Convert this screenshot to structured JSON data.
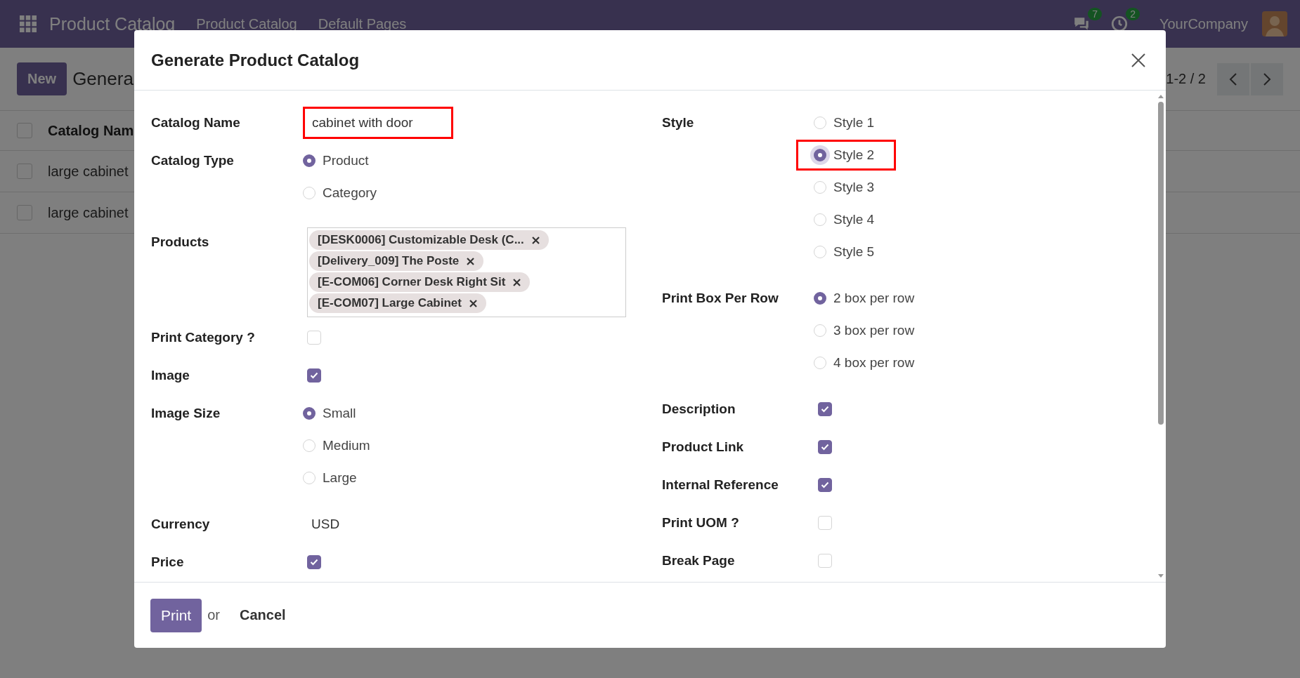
{
  "navbar": {
    "brand": "Product Catalog",
    "menus": [
      "Product Catalog",
      "Default Pages"
    ],
    "messages_badge": "7",
    "activities_badge": "2",
    "company": "YourCompany"
  },
  "control_panel": {
    "new_button": "New",
    "breadcrumb": "Genera",
    "pager": "1-2 / 2"
  },
  "list": {
    "select_all_checked": false,
    "columns": [
      "Catalog Nam"
    ],
    "rows": [
      {
        "checked": false,
        "cells": [
          "large cabinet"
        ]
      },
      {
        "checked": false,
        "cells": [
          "large cabinet"
        ]
      }
    ]
  },
  "dialog": {
    "title": "Generate Product Catalog",
    "left_fields": [
      {
        "label": "Catalog Name",
        "kind": "text",
        "value": "cabinet with door",
        "highlighted": true
      },
      {
        "label": "Catalog Type",
        "kind": "radio",
        "options": [
          {
            "label": "Product",
            "selected": true
          },
          {
            "label": "Category",
            "selected": false
          }
        ]
      },
      {
        "label": "Products",
        "kind": "tags",
        "tags": [
          "[DESK0006] Customizable Desk (C...",
          "[Delivery_009] The Poste",
          "[E-COM06] Corner Desk Right Sit",
          "[E-COM07] Large Cabinet"
        ]
      },
      {
        "label": "Print Category ?",
        "kind": "checkbox",
        "checked": false
      },
      {
        "label": "Image",
        "kind": "checkbox",
        "checked": true
      },
      {
        "label": "Image Size",
        "kind": "radio",
        "options": [
          {
            "label": "Small",
            "selected": true
          },
          {
            "label": "Medium",
            "selected": false
          },
          {
            "label": "Large",
            "selected": false
          }
        ]
      },
      {
        "label": "Currency",
        "kind": "value",
        "value": "USD"
      },
      {
        "label": "Price",
        "kind": "checkbox",
        "checked": true
      }
    ],
    "right_fields": [
      {
        "label": "Style",
        "kind": "radio",
        "options": [
          {
            "label": "Style 1",
            "selected": false,
            "highlighted": false
          },
          {
            "label": "Style 2",
            "selected": true,
            "highlighted": true
          },
          {
            "label": "Style 3",
            "selected": false,
            "highlighted": false
          },
          {
            "label": "Style 4",
            "selected": false,
            "highlighted": false
          },
          {
            "label": "Style 5",
            "selected": false,
            "highlighted": false
          }
        ]
      },
      {
        "label": "Print Box Per Row",
        "kind": "radio",
        "options": [
          {
            "label": "2 box per row",
            "selected": true
          },
          {
            "label": "3 box per row",
            "selected": false
          },
          {
            "label": "4 box per row",
            "selected": false
          }
        ]
      },
      {
        "label": "Description",
        "kind": "checkbox",
        "checked": true
      },
      {
        "label": "Product Link",
        "kind": "checkbox",
        "checked": true
      },
      {
        "label": "Internal Reference",
        "kind": "checkbox",
        "checked": true
      },
      {
        "label": "Print UOM ?",
        "kind": "checkbox",
        "checked": false
      },
      {
        "label": "Break Page",
        "kind": "checkbox",
        "checked": false
      }
    ],
    "footer": {
      "primary": "Print",
      "separator": "or",
      "secondary": "Cancel"
    }
  }
}
